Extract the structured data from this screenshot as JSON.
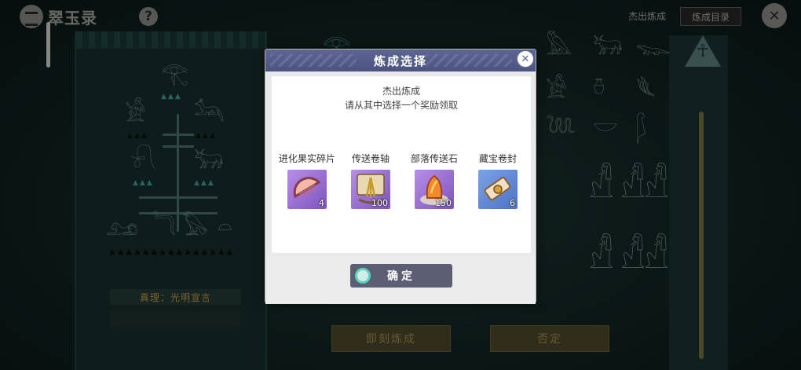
{
  "app": {
    "title": "翠玉录"
  },
  "topbar": {
    "help_symbol": "?",
    "outstanding_link": "杰出炼成",
    "catalog_button": "炼成目录",
    "exit_symbol": "✕"
  },
  "background": {
    "truth_label": "真理：光明宣言",
    "button_forge": "即刻炼成",
    "button_reject": "否定"
  },
  "modal": {
    "title": "炼成选择",
    "close_symbol": "✕",
    "body_title": "杰出炼成",
    "body_subtitle": "请从其中选择一个奖励领取",
    "rewards": [
      {
        "name": "进化果实碎片",
        "count": "4",
        "icon": "fruit-slice-icon"
      },
      {
        "name": "传送卷轴",
        "count": "100",
        "icon": "teleport-scroll-icon"
      },
      {
        "name": "部落传送石",
        "count": "150",
        "icon": "tribe-teleport-stone-icon"
      },
      {
        "name": "藏宝卷封",
        "count": "6",
        "icon": "treasure-scroll-icon"
      }
    ],
    "confirm_button": "确定"
  },
  "colors": {
    "modal_header": "#5d6691",
    "confirm_button": "#5c5f73",
    "rarity_purple": "#9a72d6",
    "rarity_blue": "#5f86d4",
    "truth_text": "#c9a24a"
  }
}
